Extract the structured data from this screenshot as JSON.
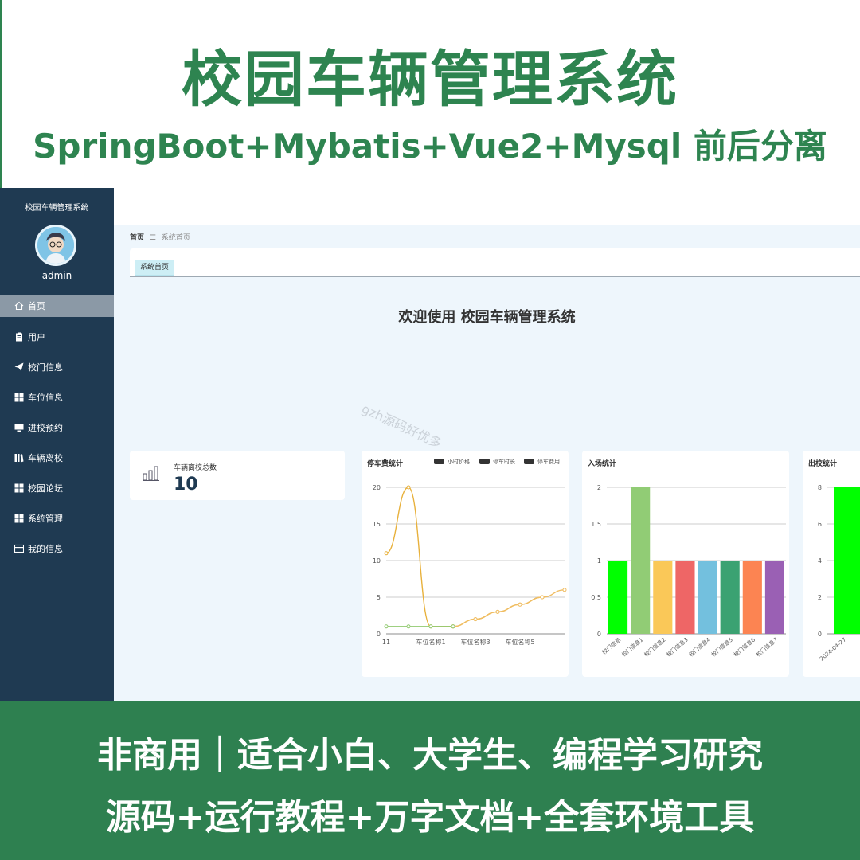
{
  "banner": {
    "title": "校园车辆管理系统",
    "subtitle": "SpringBoot+Mybatis+Vue2+Mysql 前后分离"
  },
  "sidebar": {
    "title": "校园车辆管理系统",
    "username": "admin",
    "items": [
      {
        "label": "首页",
        "icon": "home-icon",
        "active": true
      },
      {
        "label": "用户",
        "icon": "clipboard-icon"
      },
      {
        "label": "校门信息",
        "icon": "paper-plane-icon"
      },
      {
        "label": "车位信息",
        "icon": "grid-icon"
      },
      {
        "label": "进校预约",
        "icon": "monitor-icon"
      },
      {
        "label": "车辆离校",
        "icon": "book-icon"
      },
      {
        "label": "校园论坛",
        "icon": "grid-icon"
      },
      {
        "label": "系统管理",
        "icon": "grid-icon"
      },
      {
        "label": "我的信息",
        "icon": "card-icon"
      }
    ]
  },
  "header": {
    "breadcrumb_home": "首页",
    "breadcrumb_sep": "☰",
    "breadcrumb_current": "系统首页",
    "tab": "系统首页"
  },
  "welcome": "欢迎使用 校园车辆管理系统",
  "watermark": "gzh源码好优多",
  "stat": {
    "label": "车辆离校总数",
    "value": "10"
  },
  "colors": {
    "brand_green": "#2e8450",
    "sidebar_bg": "#1f3a52"
  },
  "chart_data": [
    {
      "type": "line",
      "title": "停车费统计",
      "legend": [
        "小时价格",
        "停车时长",
        "停车费用"
      ],
      "legend_position": "top-right",
      "x_ticks": [
        "11",
        "车位名称1",
        "车位名称3",
        "车位名称5"
      ],
      "ylim": [
        0,
        20
      ],
      "y_ticks": [
        0,
        5,
        10,
        15,
        20
      ],
      "series": [
        {
          "name": "小时价格",
          "color": "#e8b13c",
          "x": [
            0,
            1,
            2,
            3,
            4,
            5,
            6,
            7
          ],
          "values": [
            11,
            20,
            1,
            1,
            2,
            3,
            4,
            5
          ]
        },
        {
          "name": "停车费用",
          "color": "#f0bd62",
          "x": [
            3,
            4,
            5,
            6,
            7,
            8
          ],
          "values": [
            1,
            2,
            3,
            4,
            5,
            6
          ]
        },
        {
          "name": "停车时长",
          "color": "#90c96f",
          "x": [
            0,
            1,
            2,
            3
          ],
          "values": [
            1,
            1,
            1,
            1
          ]
        }
      ],
      "grid": true
    },
    {
      "type": "bar",
      "title": "入场统计",
      "categories": [
        "校门信息",
        "校门信息1",
        "校门信息2",
        "校门信息3",
        "校门信息4",
        "校门信息5",
        "校门信息6",
        "校门信息7"
      ],
      "values": [
        1,
        2,
        1,
        1,
        1,
        1,
        1,
        1
      ],
      "bar_colors": [
        "#00ff00",
        "#91cc75",
        "#fac858",
        "#ee6666",
        "#73c0de",
        "#3ba272",
        "#fc8452",
        "#9a60b4"
      ],
      "ylim": [
        0,
        2
      ],
      "y_ticks": [
        0,
        0.5,
        1,
        1.5,
        2
      ],
      "grid": true
    },
    {
      "type": "bar",
      "title": "出校统计",
      "categories": [
        "2024-04-27"
      ],
      "values": [
        8
      ],
      "bar_colors": [
        "#00ff00"
      ],
      "ylim": [
        0,
        8
      ],
      "y_ticks": [
        0,
        2,
        4,
        6,
        8
      ],
      "grid": true
    }
  ],
  "footer": {
    "line1": "非商用｜适合小白、大学生、编程学习研究",
    "line2": "源码+运行教程+万字文档+全套环境工具"
  }
}
